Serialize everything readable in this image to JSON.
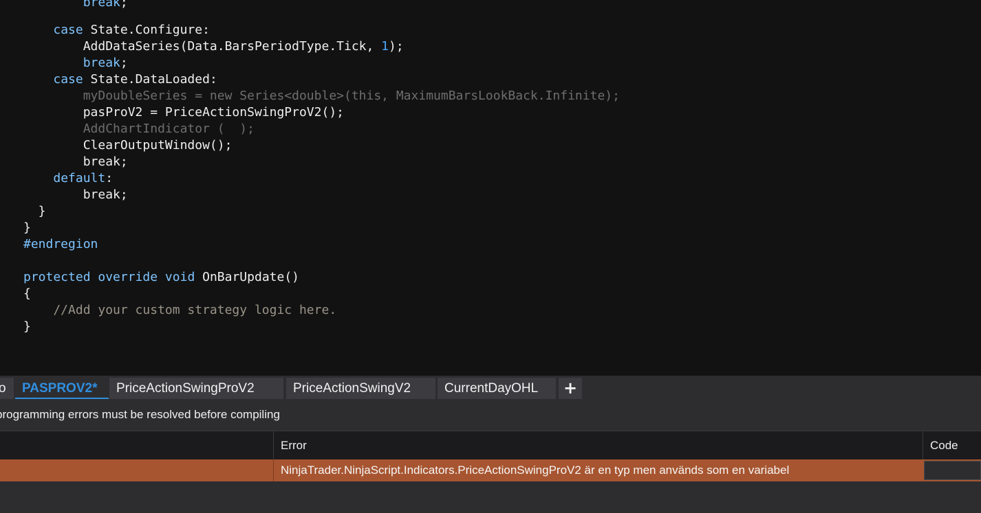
{
  "editor": {
    "lines": {
      "l0": {
        "a": "        ",
        "b": "break",
        "c": ";"
      },
      "l1": {
        "a": "    ",
        "b": "case",
        "c": " State.Configure:"
      },
      "l2": {
        "a": "        AddDataSeries(Data.BarsPeriodType.Tick, ",
        "b": "1",
        "c": ");"
      },
      "l3": {
        "a": "        ",
        "b": "break",
        "c": ";"
      },
      "l4": {
        "a": "    ",
        "b": "case",
        "c": " State.DataLoaded:"
      },
      "l5": {
        "a": "        myDoubleSeries = new Series<double>(this, MaximumBarsLookBack.Infinite);"
      },
      "l6": {
        "a": "        pasProV2 = PriceActionSwingProV2();"
      },
      "l7": {
        "a": "        AddChartIndicator (  );"
      },
      "l8": {
        "a": "        ClearOutputWindow();"
      },
      "l9": {
        "a": "        break;"
      },
      "l10": {
        "a": "    ",
        "b": "default",
        "c": ":"
      },
      "l11": {
        "a": "        break;"
      },
      "l12": {
        "a": "  }"
      },
      "l13": {
        "a": "}"
      },
      "l14": {
        "a": "#endregion"
      },
      "l15": {
        "a": "protected",
        "b": " override",
        "c": " void",
        "d": " OnBarUpdate()"
      },
      "l16": {
        "a": "{"
      },
      "l17": {
        "a": "    //Add your custom strategy logic here."
      },
      "l18": {
        "a": "}"
      }
    }
  },
  "tabs": {
    "partial_left": "o",
    "items": [
      {
        "label": "PASPROV2*"
      },
      {
        "label": "PriceActionSwingProV2"
      },
      {
        "label": "PriceActionSwingV2"
      },
      {
        "label": "CurrentDayOHL"
      }
    ],
    "add_label": "+"
  },
  "errors_panel": {
    "status_message": "programming errors must be resolved before compiling",
    "columns": {
      "error": "Error",
      "code": "Code"
    },
    "rows": [
      {
        "error": "NinjaTrader.NinjaScript.Indicators.PriceActionSwingProV2 är en typ men används som en variabel",
        "code": ""
      }
    ]
  },
  "colors": {
    "editor_bg": "#121212",
    "keyword": "#7fc4ff",
    "number": "#4aa8ff",
    "comment": "#9a9489",
    "active_tab": "#2f8fe0",
    "error_row": "#a75530",
    "panel_bg": "#2d2d30"
  }
}
